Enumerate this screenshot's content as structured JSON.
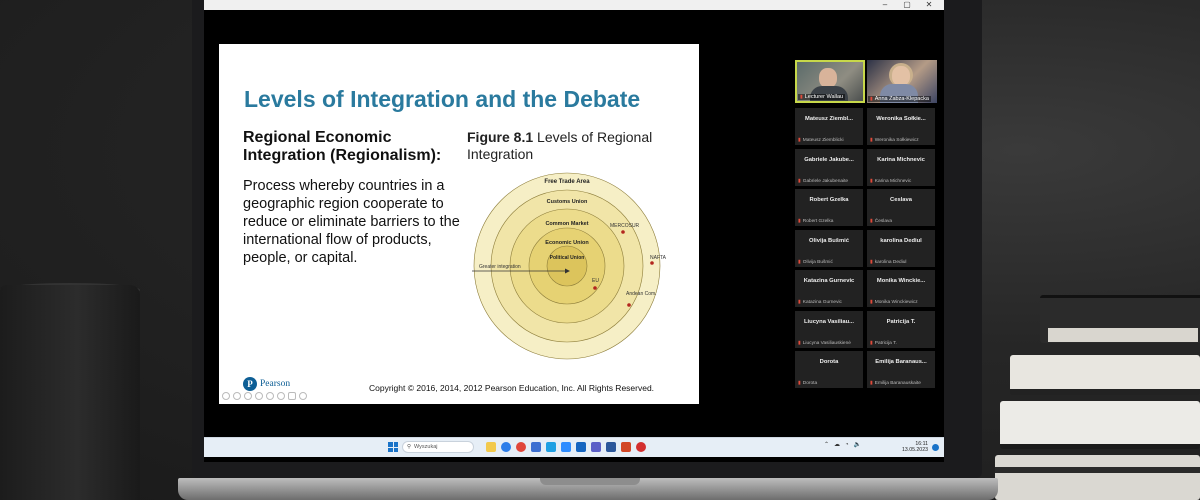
{
  "window": {
    "minimize": "–",
    "maximize": "▢",
    "close": "✕"
  },
  "slide": {
    "title": "Levels of Integration and the Debate",
    "subtitle": "Regional Economic Integration (Regionalism):",
    "body": "Process whereby countries in a geographic region cooperate to reduce or eliminate barriers to the international flow of products, people, or capital.",
    "figure_label": "Figure 8.1",
    "figure_caption": "Levels of Regional Integration",
    "figure": {
      "rings": [
        "Free Trade Area",
        "Customs Union",
        "Common Market",
        "Economic Union",
        "Political Union"
      ],
      "arrow_label": "Greater integration",
      "points": [
        "MERCOSUR",
        "NAFTA",
        "EU",
        "Andean Com."
      ],
      "colors": {
        "outer": "#f6efc6",
        "ring2": "#f1e5a8",
        "ring3": "#ecdc8c",
        "ring4": "#e6d273",
        "core": "#dcc45c",
        "dot": "#b3261e"
      }
    },
    "copyright": "Copyright © 2016, 2014, 2012 Pearson Education, Inc. All Rights Reserved.",
    "publisher": "Pearson"
  },
  "participants": {
    "videos": [
      {
        "name": "Lecturer Wallau"
      },
      {
        "name": "Anna Zabza-Klepacka"
      }
    ],
    "tiles": [
      {
        "name": "Mateusz Ziembl...",
        "sub": "Mateusz Ziemblicki"
      },
      {
        "name": "Weronika Sołkie...",
        "sub": "Weronika Sołkiewicz"
      },
      {
        "name": "Gabriele Jakube...",
        "sub": "Gabriele Jakubenaite"
      },
      {
        "name": "Karina Michnevic",
        "sub": "Karina Michnevic"
      },
      {
        "name": "Robert Gzelka",
        "sub": "Robert Gzelka"
      },
      {
        "name": "Česlava",
        "sub": "Česlava"
      },
      {
        "name": "Olivija Bušmić",
        "sub": "Olivija Bušmić"
      },
      {
        "name": "karolina Dediul",
        "sub": "karolina Dediul"
      },
      {
        "name": "Katazina Gurnevic",
        "sub": "Katazina Gurnevic"
      },
      {
        "name": "Monika Winckie...",
        "sub": "Monika Winckiewicz"
      },
      {
        "name": "Liucyna Vasiliau...",
        "sub": "Liucyna Vasiliauskienė"
      },
      {
        "name": "Patricija T.",
        "sub": "Patricija T."
      },
      {
        "name": "Dorota",
        "sub": "Dorota"
      },
      {
        "name": "Emilija Baranaus...",
        "sub": "Emilija Baranauskaite"
      }
    ]
  },
  "taskbar": {
    "search_placeholder": "Wyszukaj",
    "time": "16:11",
    "date": "13.05.2023",
    "icons": [
      "file-explorer-icon",
      "edge-icon",
      "chrome-icon",
      "store-icon",
      "skype-icon",
      "zoom-icon",
      "outlook-icon",
      "teams-icon",
      "word-icon",
      "powerpoint-icon",
      "opera-icon"
    ]
  }
}
